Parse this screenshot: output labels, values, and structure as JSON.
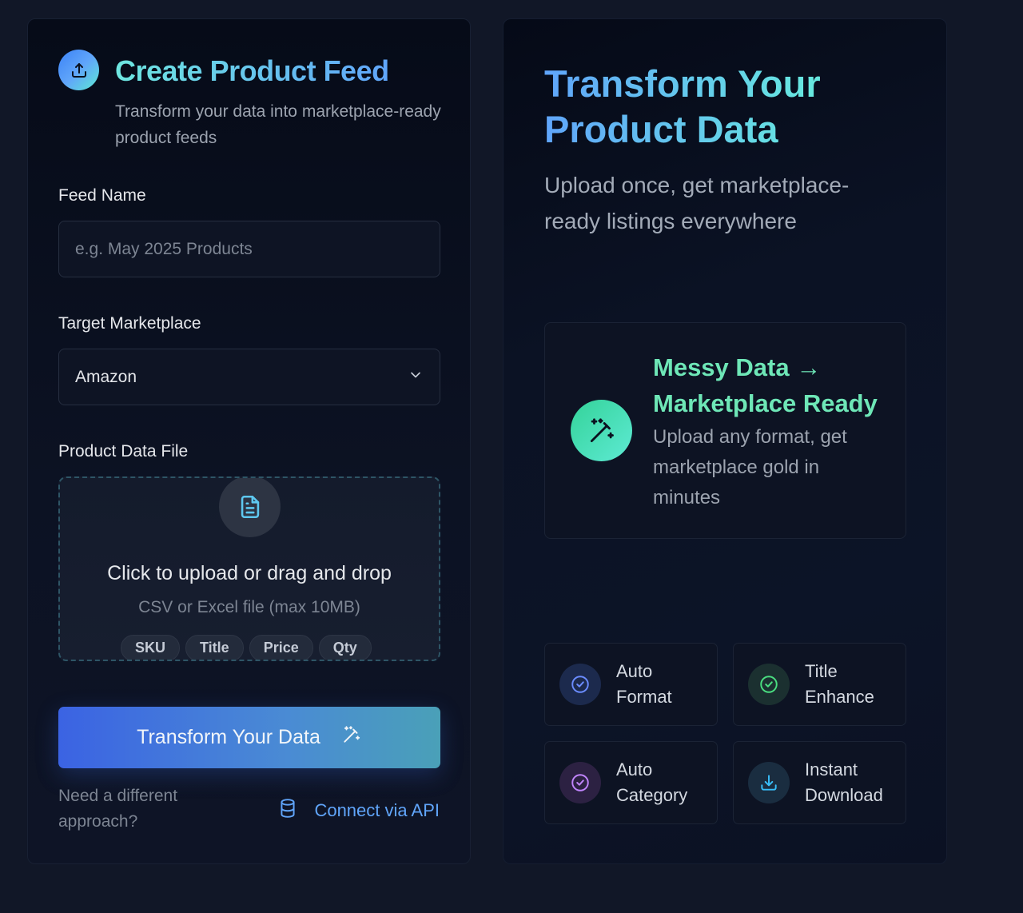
{
  "form": {
    "title": "Create Product Feed",
    "subtitle": "Transform your data into marketplace-ready product feeds",
    "feed_name_label": "Feed Name",
    "feed_name_placeholder": "e.g. May 2025 Products",
    "marketplace_label": "Target Marketplace",
    "marketplace_value": "Amazon",
    "file_label": "Product Data File",
    "dropzone_title": "Click to upload or drag and drop",
    "dropzone_sub": "CSV or Excel file (max 10MB)",
    "tags": [
      "SKU",
      "Title",
      "Price",
      "Qty"
    ],
    "cta_label": "Transform Your Data",
    "alt_text": "Need a different approach?",
    "api_link": "Connect via API"
  },
  "hero": {
    "title": "Transform Your Product Data",
    "subtitle": "Upload once, get marketplace-ready listings everywhere",
    "feature_title": "Messy Data → Marketplace Ready",
    "feature_desc": "Upload any format, get marketplace gold in minutes",
    "features": [
      {
        "label": "Auto Format",
        "icon": "check-circle-icon",
        "color": "#6b8cff",
        "bg": "#1c2a4d"
      },
      {
        "label": "Title Enhance",
        "icon": "check-circle-icon",
        "color": "#4ade80",
        "bg": "#1b3030"
      },
      {
        "label": "Auto Category",
        "icon": "check-circle-icon",
        "color": "#c084fc",
        "bg": "#2c2142"
      },
      {
        "label": "Instant Download",
        "icon": "download-icon",
        "color": "#38bdf8",
        "bg": "#1a2d40"
      }
    ]
  },
  "colors": {
    "background": "#111727",
    "accent_blue": "#60a5fa",
    "accent_green": "#6ee7b7"
  }
}
